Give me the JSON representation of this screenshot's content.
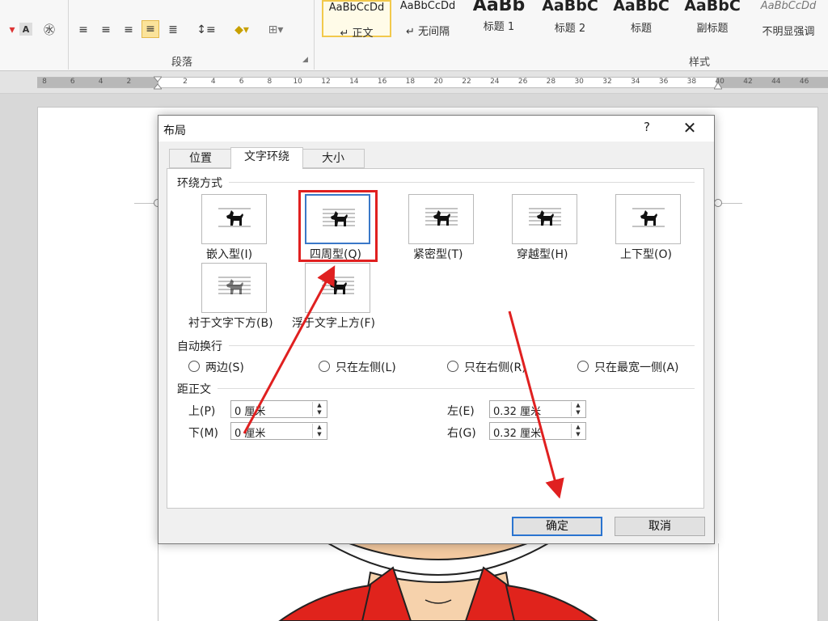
{
  "ribbon": {
    "paragraph_group_label": "段落",
    "styles_group_label": "样式",
    "styles": [
      {
        "preview": "AaBbCcDd",
        "name": "↵ 正文"
      },
      {
        "preview": "AaBbCcDd",
        "name": "↵ 无间隔"
      },
      {
        "preview": "AaBb",
        "name": "标题 1"
      },
      {
        "preview": "AaBbC",
        "name": "标题 2"
      },
      {
        "preview": "AaBbC",
        "name": "标题"
      },
      {
        "preview": "AaBbC",
        "name": "副标题"
      },
      {
        "preview": "AaBbCcDd",
        "name": "不明显强调"
      }
    ]
  },
  "ruler": {
    "labels": [
      "8",
      "6",
      "4",
      "2",
      "",
      "2",
      "4",
      "6",
      "8",
      "10",
      "12",
      "14",
      "16",
      "18",
      "20",
      "22",
      "24",
      "26",
      "28",
      "30",
      "32",
      "34",
      "36",
      "38",
      "40",
      "42",
      "44",
      "46"
    ]
  },
  "dialog": {
    "title": "布局",
    "help": "?",
    "close": "✕",
    "tabs": [
      "位置",
      "文字环绕",
      "大小"
    ],
    "wrap_section": "环绕方式",
    "wrap_options": [
      {
        "label": "嵌入型(I)"
      },
      {
        "label": "四周型(Q)"
      },
      {
        "label": "紧密型(T)"
      },
      {
        "label": "穿越型(H)"
      },
      {
        "label": "上下型(O)"
      },
      {
        "label": "衬于文字下方(B)"
      },
      {
        "label": "浮于文字上方(F)"
      }
    ],
    "selected_wrap": "四周型(Q)",
    "auto_wrap_section": "自动换行",
    "auto_wrap_options": [
      "两边(S)",
      "只在左侧(L)",
      "只在右侧(R)",
      "只在最宽一侧(A)"
    ],
    "distance_section": "距正文",
    "distance": {
      "top_label": "上(P)",
      "top_value": "0 厘米",
      "bottom_label": "下(M)",
      "bottom_value": "0 厘米",
      "left_label": "左(E)",
      "left_value": "0.32 厘米",
      "right_label": "右(G)",
      "right_value": "0.32 厘米"
    },
    "ok": "确定",
    "cancel": "取消"
  },
  "annotation_color": "#e02020",
  "accent_color": "#3a78c8"
}
